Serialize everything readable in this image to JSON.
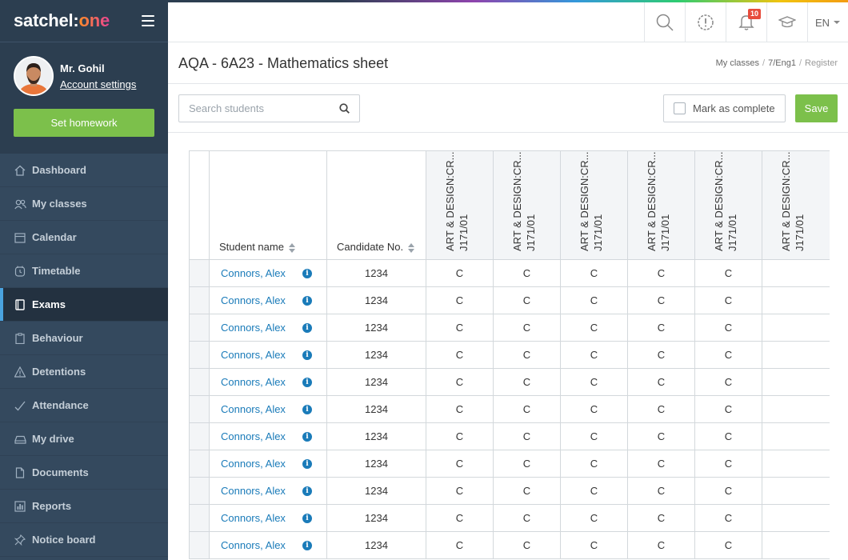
{
  "app": {
    "logo_main": "satchel:",
    "logo_accent": "one"
  },
  "user": {
    "name": "Mr. Gohil",
    "account_link": "Account settings"
  },
  "sidebar": {
    "set_homework_label": "Set homework",
    "items": [
      {
        "label": "Dashboard",
        "icon": "home-icon"
      },
      {
        "label": "My classes",
        "icon": "users-icon"
      },
      {
        "label": "Calendar",
        "icon": "calendar-icon"
      },
      {
        "label": "Timetable",
        "icon": "clock-icon"
      },
      {
        "label": "Exams",
        "icon": "notebook-icon",
        "active": true
      },
      {
        "label": "Behaviour",
        "icon": "clipboard-icon"
      },
      {
        "label": "Detentions",
        "icon": "warning-icon"
      },
      {
        "label": "Attendance",
        "icon": "check-icon"
      },
      {
        "label": "My drive",
        "icon": "drive-icon"
      },
      {
        "label": "Documents",
        "icon": "document-icon"
      },
      {
        "label": "Reports",
        "icon": "chart-icon"
      },
      {
        "label": "Notice board",
        "icon": "pin-icon"
      }
    ]
  },
  "topbar": {
    "notification_count": "10",
    "language": "EN"
  },
  "page": {
    "title": "AQA - 6A23 - Mathematics sheet",
    "breadcrumb": [
      "My classes",
      "7/Eng1",
      "Register"
    ]
  },
  "toolbar": {
    "search_placeholder": "Search students",
    "mark_complete_label": "Mark as complete",
    "save_label": "Save"
  },
  "table": {
    "columns": {
      "student_name": "Student name",
      "candidate_no": "Candidate No.",
      "components": [
        {
          "line1": "ART & DESIGN:CR...",
          "line2": "J171/01"
        },
        {
          "line1": "ART & DESIGN:CR...",
          "line2": "J171/01"
        },
        {
          "line1": "ART & DESIGN:CR...",
          "line2": "J171/01"
        },
        {
          "line1": "ART & DESIGN:CR...",
          "line2": "J171/01"
        },
        {
          "line1": "ART & DESIGN:CR...",
          "line2": "J171/01"
        },
        {
          "line1": "ART & DESIGN:CR...",
          "line2": "J171/01"
        }
      ]
    },
    "rows": [
      {
        "name": "Connors, Alex",
        "candidate": "1234",
        "grades": [
          "C",
          "C",
          "C",
          "C",
          "C",
          ""
        ]
      },
      {
        "name": "Connors, Alex",
        "candidate": "1234",
        "grades": [
          "C",
          "C",
          "C",
          "C",
          "C",
          ""
        ]
      },
      {
        "name": "Connors, Alex",
        "candidate": "1234",
        "grades": [
          "C",
          "C",
          "C",
          "C",
          "C",
          ""
        ]
      },
      {
        "name": "Connors, Alex",
        "candidate": "1234",
        "grades": [
          "C",
          "C",
          "C",
          "C",
          "C",
          ""
        ]
      },
      {
        "name": "Connors, Alex",
        "candidate": "1234",
        "grades": [
          "C",
          "C",
          "C",
          "C",
          "C",
          ""
        ]
      },
      {
        "name": "Connors, Alex",
        "candidate": "1234",
        "grades": [
          "C",
          "C",
          "C",
          "C",
          "C",
          ""
        ]
      },
      {
        "name": "Connors, Alex",
        "candidate": "1234",
        "grades": [
          "C",
          "C",
          "C",
          "C",
          "C",
          ""
        ]
      },
      {
        "name": "Connors, Alex",
        "candidate": "1234",
        "grades": [
          "C",
          "C",
          "C",
          "C",
          "C",
          ""
        ]
      },
      {
        "name": "Connors, Alex",
        "candidate": "1234",
        "grades": [
          "C",
          "C",
          "C",
          "C",
          "C",
          ""
        ]
      },
      {
        "name": "Connors, Alex",
        "candidate": "1234",
        "grades": [
          "C",
          "C",
          "C",
          "C",
          "C",
          ""
        ]
      },
      {
        "name": "Connors, Alex",
        "candidate": "1234",
        "grades": [
          "C",
          "C",
          "C",
          "C",
          "C",
          ""
        ]
      }
    ]
  }
}
